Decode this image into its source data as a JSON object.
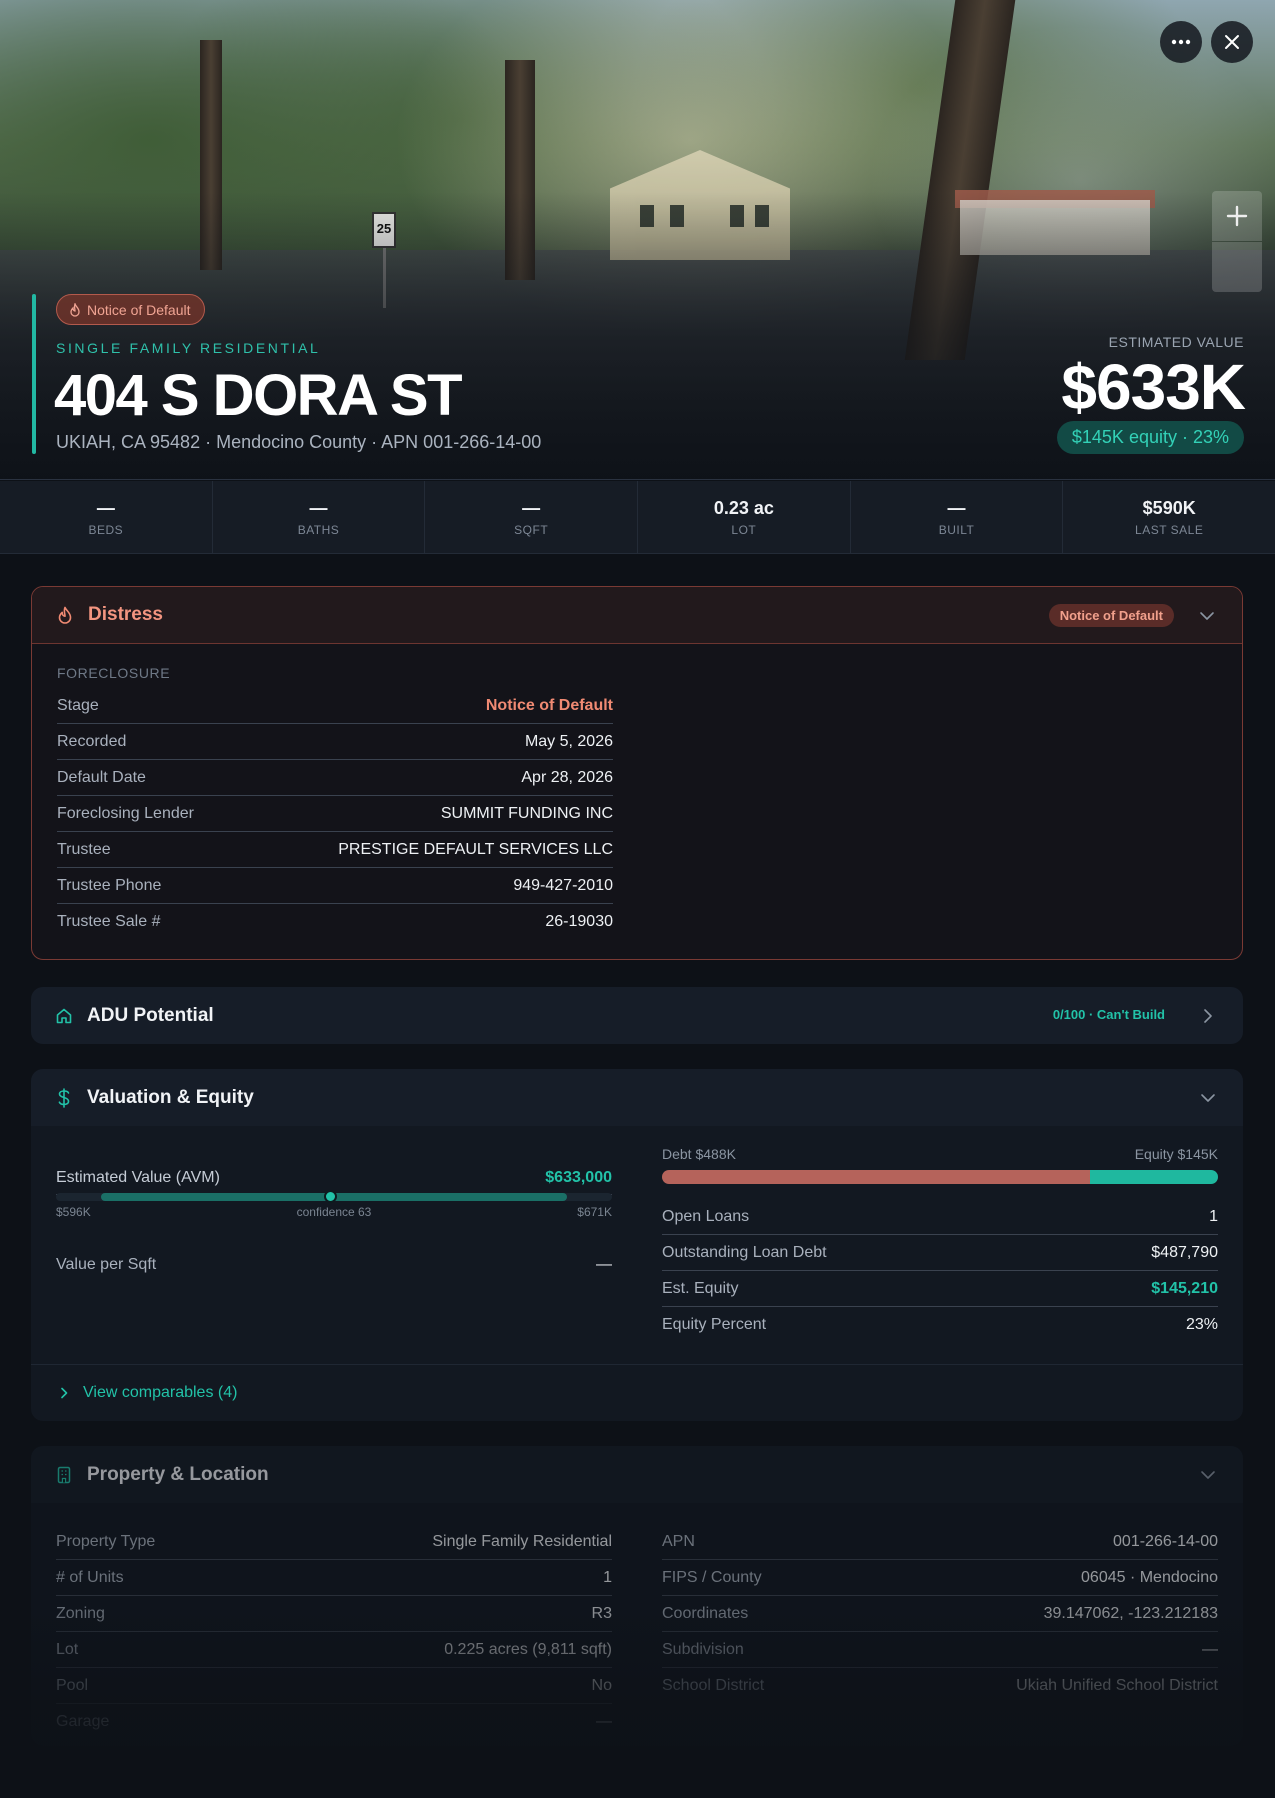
{
  "hero": {
    "distress_badge": "Notice of Default",
    "property_type": "SINGLE FAMILY RESIDENTIAL",
    "address": "404 S DORA ST",
    "sub_address": "UKIAH, CA 95482 · Mendocino County · APN 001-266-14-00",
    "estimated_label": "ESTIMATED VALUE",
    "estimated_value": "$633K",
    "equity_pill": "$145K equity · 23%",
    "street_sign": "25",
    "more_icon": "more-icon",
    "close_icon": "close-icon",
    "zoom_in_icon": "plus-icon"
  },
  "stats": [
    {
      "value": "—",
      "label": "BEDS"
    },
    {
      "value": "—",
      "label": "BATHS"
    },
    {
      "value": "—",
      "label": "SQFT"
    },
    {
      "value": "0.23 ac",
      "label": "LOT"
    },
    {
      "value": "—",
      "label": "BUILT"
    },
    {
      "value": "$590K",
      "label": "LAST SALE"
    }
  ],
  "distress": {
    "title": "Distress",
    "icon": "flame-icon",
    "badge": "Notice of Default",
    "section": "FORECLOSURE",
    "rows": [
      {
        "label": "Stage",
        "value": "Notice of Default"
      },
      {
        "label": "Recorded",
        "value": "May 5, 2026"
      },
      {
        "label": "Default Date",
        "value": "Apr 28, 2026"
      },
      {
        "label": "Foreclosing Lender",
        "value": "SUMMIT FUNDING INC"
      },
      {
        "label": "Trustee",
        "value": "PRESTIGE DEFAULT SERVICES LLC"
      },
      {
        "label": "Trustee Phone",
        "value": "949-427-2010"
      },
      {
        "label": "Trustee Sale #",
        "value": "26-19030"
      }
    ]
  },
  "adu": {
    "title": "ADU Potential",
    "icon": "home-icon",
    "tag": "0/100 · Can't Build"
  },
  "valuation": {
    "title": "Valuation & Equity",
    "icon": "dollar-icon",
    "avm_label": "Estimated Value (AVM)",
    "avm_value": "$633,000",
    "range_low": "$596K",
    "range_high": "$671K",
    "confidence": "confidence 63",
    "value_fraction": 0.493,
    "vps_label": "Value per Sqft",
    "vps_value": "—",
    "debt_label": "Debt $488K",
    "equity_label": "Equity $145K",
    "debt_fraction": 0.77,
    "rows": [
      {
        "label": "Open Loans",
        "value": "1"
      },
      {
        "label": "Outstanding Loan Debt",
        "value": "$487,790"
      },
      {
        "label": "Est. Equity",
        "value": "$145,210"
      },
      {
        "label": "Equity Percent",
        "value": "23%"
      }
    ],
    "comparables": "View comparables (4)"
  },
  "property": {
    "title": "Property & Location",
    "icon": "building-icon",
    "left": [
      {
        "label": "Property Type",
        "value": "Single Family Residential"
      },
      {
        "label": "# of Units",
        "value": "1"
      },
      {
        "label": "Zoning",
        "value": "R3"
      },
      {
        "label": "Lot",
        "value": "0.225 acres (9,811 sqft)"
      },
      {
        "label": "Pool",
        "value": "No"
      },
      {
        "label": "Garage",
        "value": "—"
      }
    ],
    "right": [
      {
        "label": "APN",
        "value": "001-266-14-00"
      },
      {
        "label": "FIPS / County",
        "value": "06045 · Mendocino"
      },
      {
        "label": "Coordinates",
        "value": "39.147062, -123.212183"
      },
      {
        "label": "Subdivision",
        "value": "—"
      },
      {
        "label": "School District",
        "value": "Ukiah Unified School District"
      }
    ]
  },
  "colors": {
    "accent": "#22c2a8",
    "distress": "#f08a73",
    "debt": "#b5635b",
    "equity": "#1fb89f"
  }
}
